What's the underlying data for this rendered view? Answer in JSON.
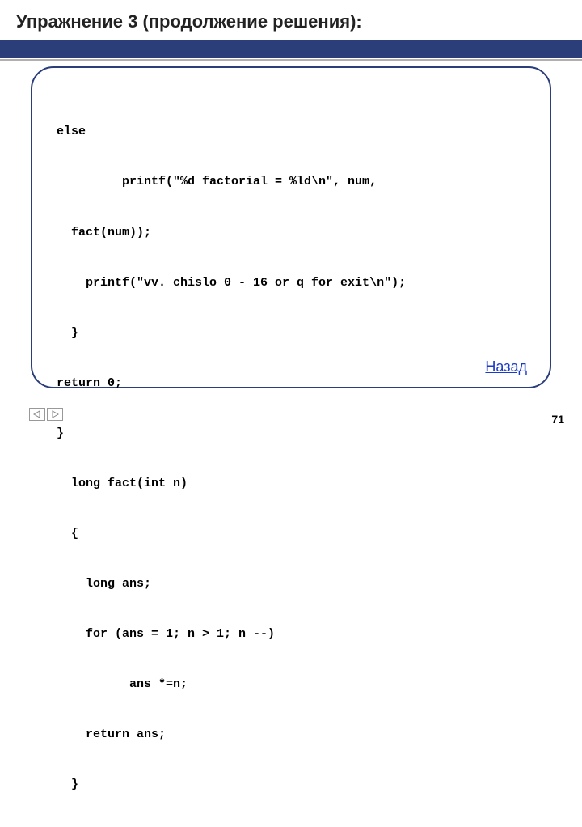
{
  "header": {
    "title": "Упражнение 3 (продолжение решения):"
  },
  "code": {
    "lines": [
      "else",
      "         printf(\"%d factorial = %ld\\n\", num,",
      "  fact(num));",
      "    printf(\"vv. chislo 0 - 16 or q for exit\\n\");",
      "  }",
      "return 0;",
      "}",
      "  long fact(int n)",
      "  {",
      "    long ans;",
      "    for (ans = 1; n > 1; n --)",
      "          ans *=n;",
      "    return ans;",
      "  }"
    ]
  },
  "link": {
    "back": "Назад"
  },
  "page": {
    "number": "71"
  }
}
